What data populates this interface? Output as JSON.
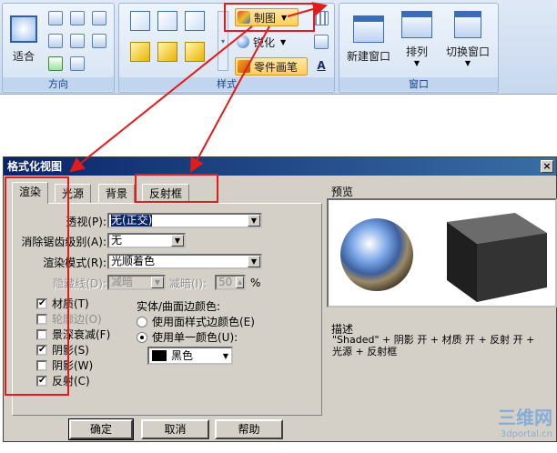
{
  "ribbon": {
    "groups": {
      "direction": {
        "title": "方向",
        "fit_label": "适合"
      },
      "style": {
        "title": "样式",
        "render_label": "制图",
        "sharpen_label": "锐化",
        "part_paint_label": "零件画笔"
      },
      "window": {
        "title": "窗口",
        "new_window_label": "新建窗口",
        "arrange_label": "排列",
        "switch_window_label": "切换窗口"
      }
    }
  },
  "dialog": {
    "title": "格式化视图",
    "close_glyph": "×",
    "tabs": [
      {
        "label": "渲染",
        "active": true
      },
      {
        "label": "光源",
        "active": false
      },
      {
        "label": "背景",
        "active": false
      },
      {
        "label": "反射框",
        "active": false
      }
    ],
    "render": {
      "perspective": {
        "label": "透视(P):",
        "value": "无(正交)"
      },
      "antialias": {
        "label": "消除锯齿级别(A):",
        "value": "无"
      },
      "render_mode": {
        "label": "渲染模式(R):",
        "value": "光顺着色"
      },
      "hidden_line": {
        "label": "隐藏线(D):",
        "value": "减暗"
      },
      "dim": {
        "label": "减暗(I):",
        "value": "50",
        "unit": "%"
      },
      "checkboxes": [
        {
          "label": "材质(T)",
          "checked": true,
          "enabled": true
        },
        {
          "label": "轮廓边(O)",
          "checked": false,
          "enabled": false
        },
        {
          "label": "景深衰减(F)",
          "checked": false,
          "enabled": true
        },
        {
          "label": "阴影(S)",
          "checked": true,
          "enabled": true
        },
        {
          "label": "阴影(W)",
          "checked": false,
          "enabled": true
        },
        {
          "label": "反射(C)",
          "checked": true,
          "enabled": true
        }
      ],
      "edge_color": {
        "title": "实体/曲面边颜色:",
        "option_style": "使用面样式边颜色(E)",
        "option_single": "使用单一颜色(U):",
        "selected": "single",
        "color_name": "黑色",
        "color_hex": "#000000"
      }
    },
    "preview_title": "预览",
    "description_title": "描述",
    "description_text": "\"Shaded\" + 阴影 开 + 材质 开 + 反射 开 +\n光源 + 反射框",
    "buttons": {
      "ok": "确定",
      "cancel": "取消",
      "help": "帮助"
    }
  },
  "watermark": {
    "brand": "三维网",
    "url": "3dportal.cn"
  },
  "colors": {
    "annotation": "#e31b1b",
    "titlebar": "#0a246a",
    "ribbon_text": "#15428b"
  }
}
